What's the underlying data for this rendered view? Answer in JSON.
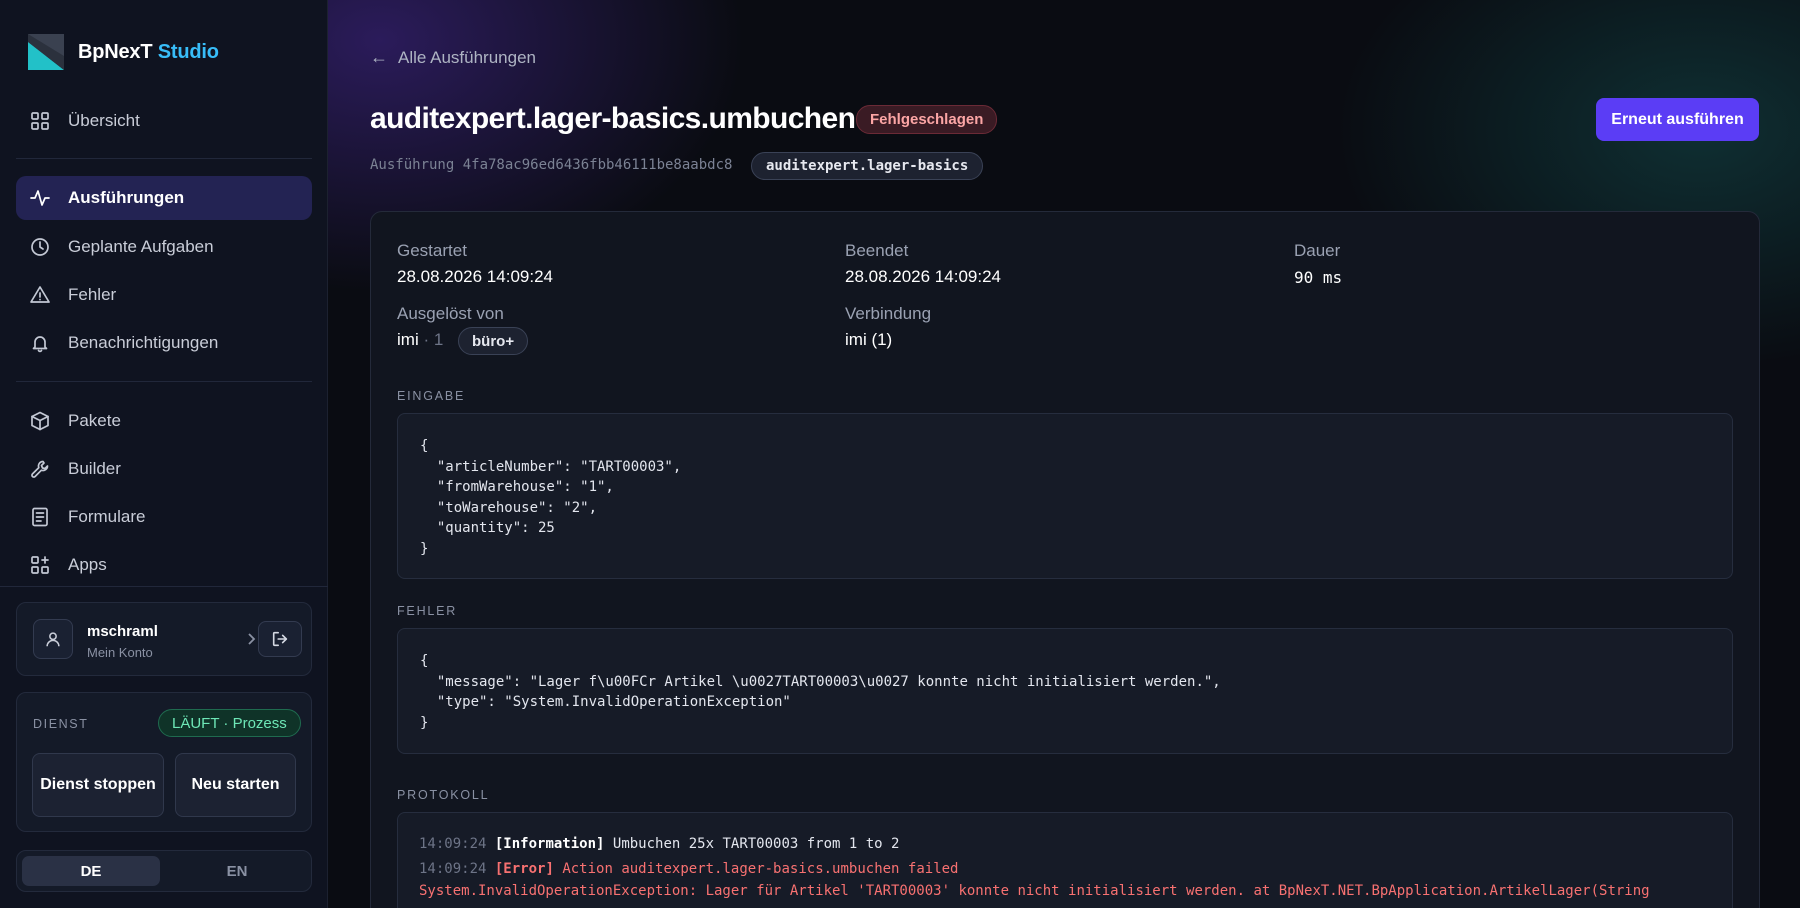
{
  "brand": {
    "name": "BpNexT",
    "name_accent": "Studio"
  },
  "sidebar": {
    "items": [
      {
        "label": "Übersicht",
        "icon": "grid-icon"
      },
      {
        "label": "Ausführungen",
        "icon": "activity-icon",
        "active": true
      },
      {
        "label": "Geplante Aufgaben",
        "icon": "clock-icon"
      },
      {
        "label": "Fehler",
        "icon": "warning-icon"
      },
      {
        "label": "Benachrichtigungen",
        "icon": "bell-icon"
      },
      {
        "label": "Pakete",
        "icon": "package-icon"
      },
      {
        "label": "Builder",
        "icon": "wrench-icon"
      },
      {
        "label": "Formulare",
        "icon": "form-icon"
      },
      {
        "label": "Apps",
        "icon": "apps-icon"
      }
    ]
  },
  "account": {
    "name": "mschraml",
    "subtitle": "Mein Konto"
  },
  "service": {
    "label": "DIENST",
    "status": "LÄUFT · Prozess",
    "stop_label": "Dienst stoppen",
    "restart_label": "Neu starten"
  },
  "language": {
    "options": [
      "DE",
      "EN"
    ],
    "selected": "DE"
  },
  "header": {
    "back_label": "Alle Ausführungen",
    "title": "auditexpert.lager-basics.umbuchen",
    "status": "Fehlgeschlagen",
    "rerun_label": "Erneut ausführen",
    "run_id": "Ausführung 4fa78ac96ed6436fbb46111be8aabdc8",
    "package": "auditexpert.lager-basics"
  },
  "details": {
    "started_label": "Gestartet",
    "started_value": "28.08.2026 14:09:24",
    "ended_label": "Beendet",
    "ended_value": "28.08.2026 14:09:24",
    "duration_label": "Dauer",
    "duration_value": "90 ms",
    "triggered_label": "Ausgelöst von",
    "triggered_user": "imi",
    "triggered_suffix": "· 1",
    "triggered_badge": "büro+",
    "connection_label": "Verbindung",
    "connection_value": "imi (1)"
  },
  "input": {
    "label": "EINGABE",
    "code": "{\n  \"articleNumber\": \"TART00003\",\n  \"fromWarehouse\": \"1\",\n  \"toWarehouse\": \"2\",\n  \"quantity\": 25\n}"
  },
  "error": {
    "label": "FEHLER",
    "code": "{\n  \"message\": \"Lager f\\u00FCr Artikel \\u0027TART00003\\u0027 konnte nicht initialisiert werden.\",\n  \"type\": \"System.InvalidOperationException\"\n}"
  },
  "log": {
    "label": "PROTOKOLL",
    "entries": [
      {
        "time": "14:09:24",
        "level": "[Information]",
        "message": "Umbuchen 25x TART00003 from 1 to 2"
      },
      {
        "time": "14:09:24",
        "level": "[Error]",
        "message": "Action auditexpert.lager-basics.umbuchen failed"
      }
    ],
    "exception": "System.InvalidOperationException: Lager für Artikel 'TART00003' konnte nicht initialisiert werden. at BpNexT.NET.BpApplication.ArtikelLager(String"
  }
}
